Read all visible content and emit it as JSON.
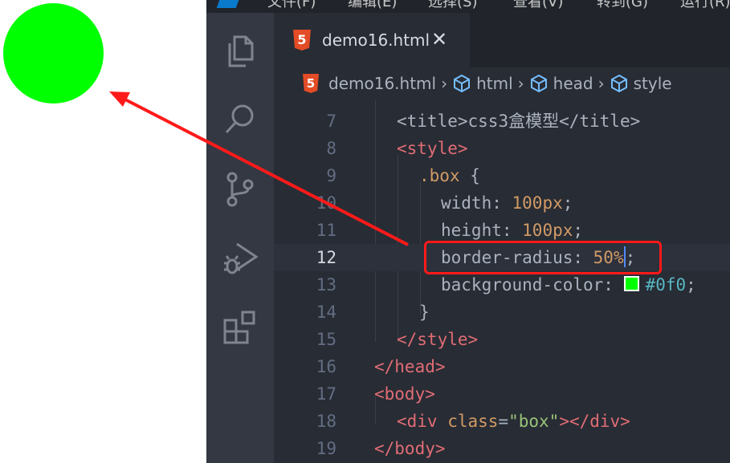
{
  "preview": {
    "circle_color": "#00ff00"
  },
  "titlebar": {
    "menu": [
      "文件(F)",
      "编辑(E)",
      "选择(S)",
      "查看(V)",
      "转到(G)",
      "运行(R)"
    ]
  },
  "activity_bar": {
    "items": [
      "files-icon",
      "search-icon",
      "source-control-icon",
      "run-debug-icon",
      "extensions-icon"
    ]
  },
  "tabs": [
    {
      "label": "demo16.html",
      "close": "✕"
    }
  ],
  "breadcrumb": {
    "file": "demo16.html",
    "items": [
      "html",
      "head",
      "style"
    ],
    "separator": "›"
  },
  "code": {
    "lines": [
      {
        "n": "7",
        "text": "<title>css3盒模型</title>"
      },
      {
        "n": "8",
        "text": "<style>"
      },
      {
        "n": "9",
        "text": ".box {"
      },
      {
        "n": "10",
        "text": "width: 100px;"
      },
      {
        "n": "11",
        "text": "height: 100px;"
      },
      {
        "n": "12",
        "text": "border-radius: 50%;"
      },
      {
        "n": "13",
        "text": "background-color: #0f0;"
      },
      {
        "n": "14",
        "text": "}"
      },
      {
        "n": "15",
        "text": "</style>"
      },
      {
        "n": "16",
        "text": "</head>"
      },
      {
        "n": "17",
        "text": "<body>"
      },
      {
        "n": "18",
        "text": "<div class=\"box\"></div>"
      },
      {
        "n": "19",
        "text": "</body>"
      }
    ],
    "active_line": "12",
    "tokens": {
      "l7_open": "<title>",
      "l7_text": "css3盒模型",
      "l7_close": "</title>",
      "l8": "<style>",
      "l9_sel": ".box",
      "l9_brace": " {",
      "l10_prop": "width: ",
      "l10_val": "100px",
      "l10_end": ";",
      "l11_prop": "height: ",
      "l11_val": "100px",
      "l11_end": ";",
      "l12_prop": "border-radius: ",
      "l12_val": "50%",
      "l12_end": ";",
      "l13_prop": "background-color: ",
      "l13_val": "#0f0",
      "l13_end": ";",
      "l14": "}",
      "l15": "</style>",
      "l16": "</head>",
      "l17": "<body>",
      "l18_open": "<div ",
      "l18_attr": "class",
      "l18_eq": "=",
      "l18_str": "\"box\"",
      "l18_close": "></div>",
      "l19": "</body>"
    }
  },
  "annotation": {
    "highlight_color": "#ff1a1a"
  }
}
